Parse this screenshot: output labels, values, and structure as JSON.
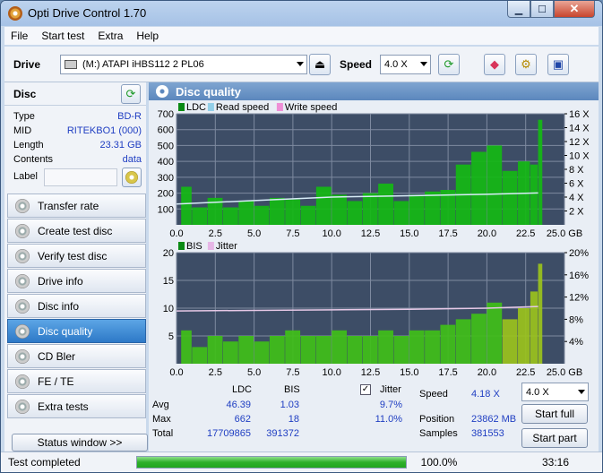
{
  "window": {
    "title": "Opti Drive Control 1.70"
  },
  "menu": [
    "File",
    "Start test",
    "Extra",
    "Help"
  ],
  "toolbar": {
    "drive_label": "Drive",
    "drive_value": "(M:)   ATAPI iHBS112   2 PL06",
    "speed_label": "Speed",
    "speed_value": "4.0 X"
  },
  "disc": {
    "heading": "Disc",
    "rows": [
      {
        "key": "Type",
        "value": "BD-R"
      },
      {
        "key": "MID",
        "value": "RITEKBO1 (000)"
      },
      {
        "key": "Length",
        "value": "23.31 GB"
      },
      {
        "key": "Contents",
        "value": "data"
      },
      {
        "key": "Label",
        "value": ""
      }
    ]
  },
  "nav": [
    "Transfer rate",
    "Create test disc",
    "Verify test disc",
    "Drive info",
    "Disc info",
    "Disc quality",
    "CD Bler",
    "FE / TE",
    "Extra tests"
  ],
  "nav_active": "Disc quality",
  "status_window_label": "Status window >>",
  "panel": {
    "title": "Disc quality"
  },
  "chart_data": [
    {
      "type": "bar",
      "legend": [
        "LDC",
        "Read speed",
        "Write speed"
      ],
      "legend_colors": [
        "#0a8a14",
        "#93cfe8",
        "#ef8fd6"
      ],
      "x_ticks": [
        "0.0",
        "2.5",
        "5.0",
        "7.5",
        "10.0",
        "12.5",
        "15.0",
        "17.5",
        "20.0",
        "22.5",
        "25.0 GB"
      ],
      "xlim": [
        0,
        25
      ],
      "y_ticks_left": [
        "100",
        "200",
        "300",
        "400",
        "500",
        "600",
        "700"
      ],
      "ylim": [
        0,
        700
      ],
      "y_ticks_right": [
        "2 X",
        "4 X",
        "6 X",
        "8 X",
        "10 X",
        "12 X",
        "14 X",
        "16 X"
      ],
      "y2lim": [
        0,
        16
      ],
      "series": [
        {
          "name": "LDC",
          "x": [
            0.3,
            1.0,
            2.0,
            3.0,
            4.0,
            5.0,
            6.0,
            7.0,
            8.0,
            9.0,
            10.0,
            11.0,
            12.0,
            13.0,
            14.0,
            15.0,
            16.0,
            17.0,
            18.0,
            19.0,
            20.0,
            21.0,
            22.0,
            22.8,
            23.3
          ],
          "values": [
            240,
            110,
            170,
            110,
            150,
            120,
            170,
            160,
            120,
            240,
            190,
            150,
            200,
            260,
            150,
            190,
            210,
            220,
            380,
            460,
            500,
            340,
            400,
            380,
            662
          ]
        },
        {
          "name": "Read speed",
          "x": [
            0,
            5,
            10,
            15,
            20,
            23.3
          ],
          "values": [
            3.0,
            3.5,
            4.0,
            4.2,
            4.4,
            4.6
          ]
        }
      ]
    },
    {
      "type": "bar",
      "legend": [
        "BIS",
        "Jitter"
      ],
      "legend_colors": [
        "#0a8a14",
        "#e6b6e6"
      ],
      "x_ticks": [
        "0.0",
        "2.5",
        "5.0",
        "7.5",
        "10.0",
        "12.5",
        "15.0",
        "17.5",
        "20.0",
        "22.5",
        "25.0 GB"
      ],
      "xlim": [
        0,
        25
      ],
      "y_ticks_left": [
        "5",
        "10",
        "15",
        "20"
      ],
      "ylim": [
        0,
        20
      ],
      "y_ticks_right": [
        "4%",
        "8%",
        "12%",
        "16%",
        "20%"
      ],
      "y2lim": [
        0,
        20
      ],
      "series": [
        {
          "name": "BIS",
          "x": [
            0.3,
            1.0,
            2.0,
            3.0,
            4.0,
            5.0,
            6.0,
            7.0,
            8.0,
            9.0,
            10.0,
            11.0,
            12.0,
            13.0,
            14.0,
            15.0,
            16.0,
            17.0,
            18.0,
            19.0,
            20.0,
            21.0,
            22.0,
            22.8,
            23.3
          ],
          "values": [
            6,
            3,
            5,
            4,
            5,
            4,
            5,
            6,
            5,
            5,
            6,
            5,
            5,
            6,
            5,
            6,
            6,
            7,
            8,
            9,
            11,
            8,
            10,
            13,
            18
          ]
        },
        {
          "name": "Jitter",
          "x": [
            0,
            5,
            10,
            15,
            20,
            23.3
          ],
          "values": [
            9.5,
            9.6,
            9.7,
            9.8,
            10.0,
            10.3
          ]
        }
      ]
    }
  ],
  "stats": {
    "col_ldc": "LDC",
    "col_bis": "BIS",
    "jitter_label": "Jitter",
    "rows": [
      {
        "label": "Avg",
        "ldc": "46.39",
        "bis": "1.03",
        "jitter": "9.7%"
      },
      {
        "label": "Max",
        "ldc": "662",
        "bis": "18",
        "jitter": "11.0%"
      },
      {
        "label": "Total",
        "ldc": "17709865",
        "bis": "391372",
        "jitter": ""
      }
    ],
    "speed_label": "Speed",
    "speed_value": "4.18 X",
    "position_label": "Position",
    "position_value": "23862 MB",
    "samples_label": "Samples",
    "samples_value": "381553",
    "speed_select": "4.0 X",
    "start_full": "Start full",
    "start_part": "Start part"
  },
  "status": {
    "text": "Test completed",
    "progress": 100.0,
    "percent_text": "100.0%",
    "time": "33:16"
  }
}
